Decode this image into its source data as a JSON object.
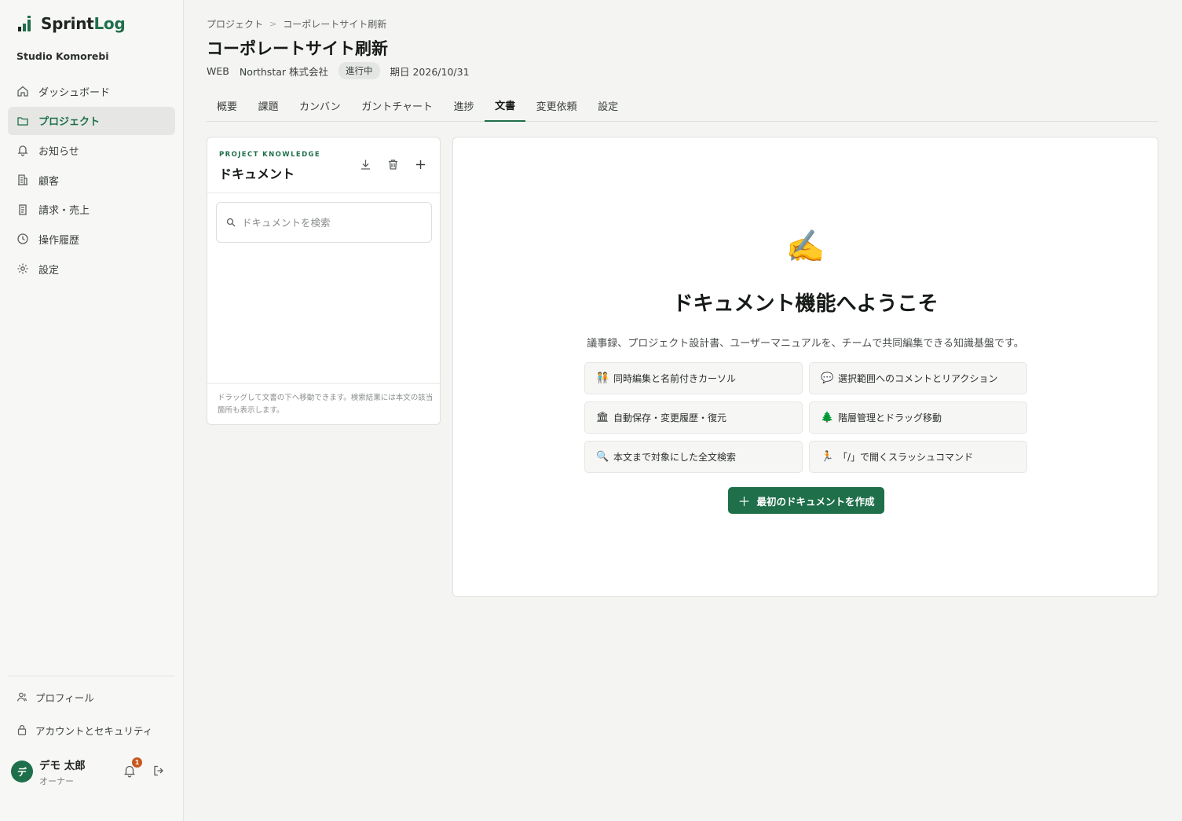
{
  "app": {
    "logo_part1": "Sprint",
    "logo_part2": "Log",
    "org": "Studio Komorebi",
    "brand_color": "#1f6f4a"
  },
  "sidebar": {
    "items": [
      {
        "label": "ダッシュボード",
        "icon": "home-icon"
      },
      {
        "label": "プロジェクト",
        "icon": "folder-icon",
        "active": true
      },
      {
        "label": "お知らせ",
        "icon": "bell-icon"
      },
      {
        "label": "顧客",
        "icon": "building-icon"
      },
      {
        "label": "請求・売上",
        "icon": "receipt-icon"
      },
      {
        "label": "操作履歴",
        "icon": "clock-icon"
      },
      {
        "label": "設定",
        "icon": "gear-icon"
      }
    ],
    "profile_label": "プロフィール",
    "security_label": "アカウントとセキュリティ",
    "user": {
      "avatar": "デ",
      "name": "デモ 太郎",
      "role": "オーナー",
      "notifications": "1"
    }
  },
  "header": {
    "breadcrumb": [
      "プロジェクト",
      "コーポレートサイト刷新"
    ],
    "breadcrumb_sep": ">",
    "title": "コーポレートサイト刷新",
    "category": "WEB",
    "client": "Northstar 株式会社",
    "status": "進行中",
    "due": "期日 2026/10/31"
  },
  "tabs": [
    {
      "label": "概要"
    },
    {
      "label": "課題"
    },
    {
      "label": "カンバン"
    },
    {
      "label": "ガントチャート"
    },
    {
      "label": "進捗"
    },
    {
      "label": "文書",
      "active": true
    },
    {
      "label": "変更依頼"
    },
    {
      "label": "設定"
    }
  ],
  "doc_panel": {
    "kicker": "PROJECT KNOWLEDGE",
    "title": "ドキュメント",
    "search_placeholder": "ドキュメントを検索",
    "footer": "ドラッグして文書の下へ移動できます。検索結果には本文の該当箇所も表示します。"
  },
  "welcome": {
    "emoji": "✍️",
    "title": "ドキュメント機能へようこそ",
    "description": "議事録、プロジェクト設計書、ユーザーマニュアルを、チームで共同編集できる知識基盤です。",
    "features": [
      {
        "emoji": "🧑‍🤝‍🧑",
        "label": "同時編集と名前付きカーソル"
      },
      {
        "emoji": "💬",
        "label": "選択範囲へのコメントとリアクション"
      },
      {
        "emoji": "🏛",
        "label": "自動保存・変更履歴・復元"
      },
      {
        "emoji": "🌲",
        "label": "階層管理とドラッグ移動"
      },
      {
        "emoji": "🔍",
        "label": "本文まで対象にした全文検索"
      },
      {
        "emoji": "🏃",
        "label": "「/」で開くスラッシュコマンド"
      }
    ],
    "cta_plus": "＋",
    "cta_label": "最初のドキュメントを作成"
  }
}
